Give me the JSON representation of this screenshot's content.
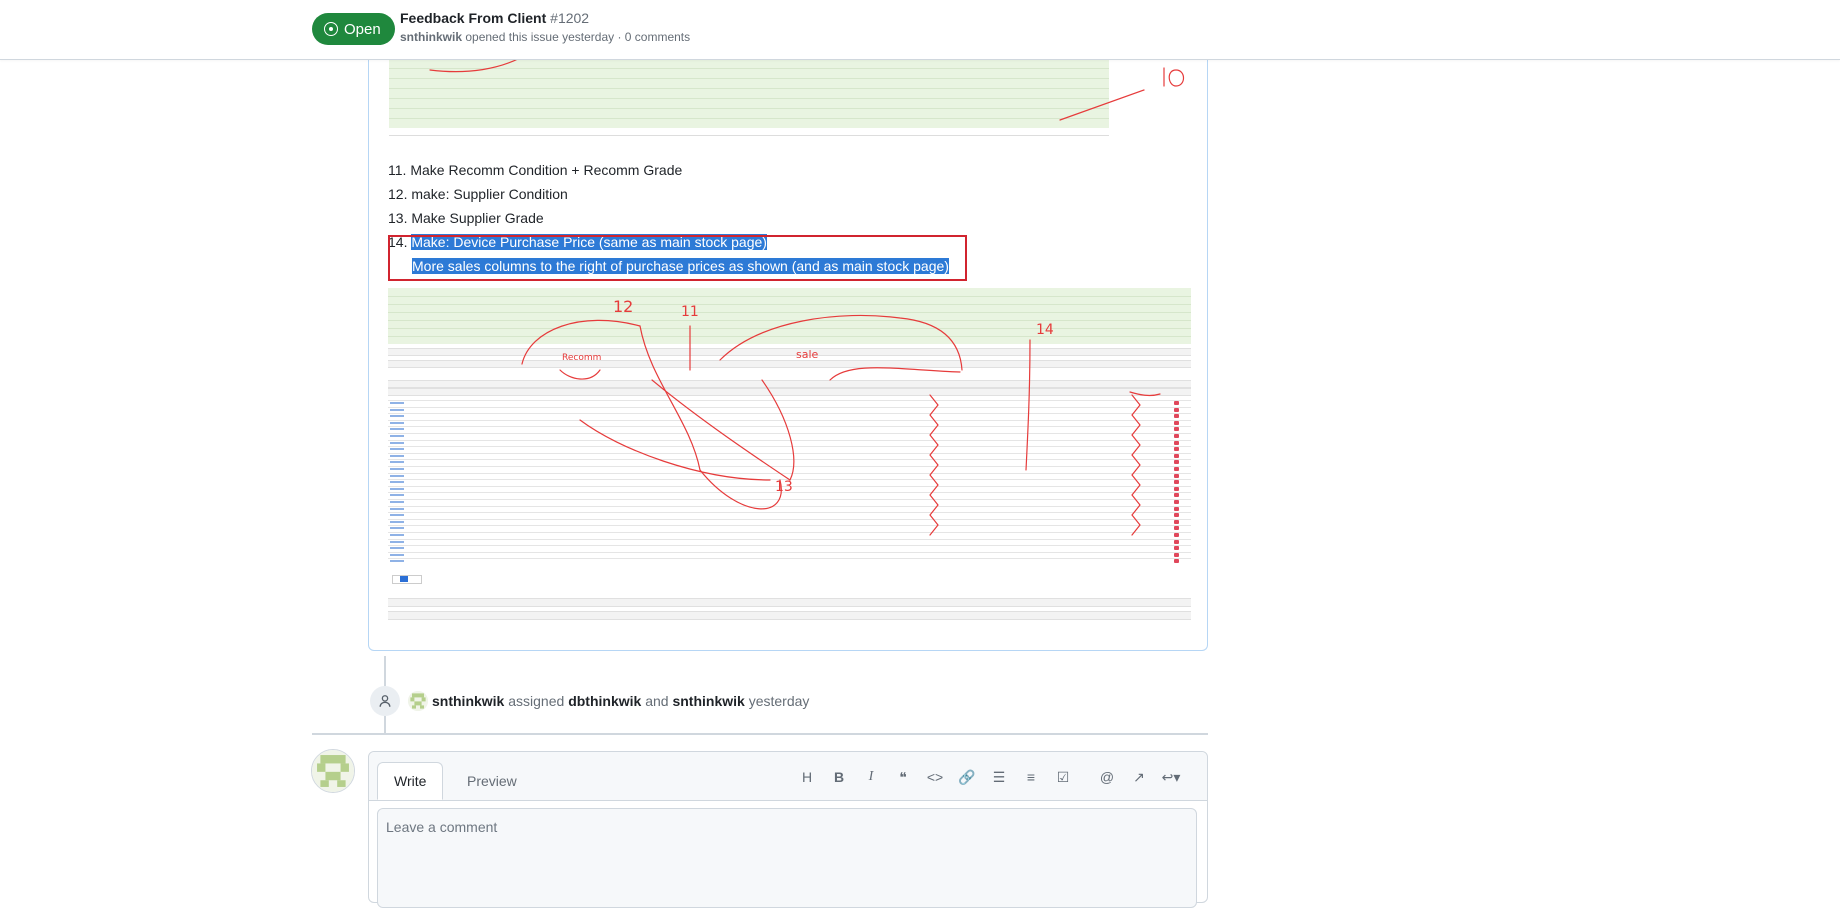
{
  "header": {
    "state": "Open",
    "title": "Feedback From Client",
    "number": "#1202",
    "author": "snthinkwik",
    "meta": "opened this issue yesterday · 0 comments"
  },
  "body": {
    "steps": [
      {
        "num": "11.",
        "text": "Make Recomm Condition + Recomm Grade"
      },
      {
        "num": "12.",
        "text": "make: Supplier Condition"
      },
      {
        "num": "13.",
        "text": "Make Supplier Grade"
      },
      {
        "num": "14.",
        "text": "Make: Device Purchase Price (same as main stock page)"
      }
    ],
    "step14_line2": "More sales columns to the right of purchase prices as shown (and as main stock page)",
    "annotations": [
      "10",
      "12",
      "11",
      "14",
      "13",
      "Recomm",
      "sale"
    ]
  },
  "event": {
    "actor": "snthinkwik",
    "verb": "assigned",
    "assignee1": "dbthinkwik",
    "and": "and",
    "assignee2": "snthinkwik",
    "when": "yesterday"
  },
  "editor": {
    "write_tab": "Write",
    "preview_tab": "Preview",
    "placeholder": "Leave a comment",
    "toolbar": [
      "heading-icon",
      "bold-icon",
      "italic-icon",
      "quote-icon",
      "code-icon",
      "link-icon",
      "unordered-list-icon",
      "ordered-list-icon",
      "task-list-icon",
      "mention-icon",
      "cross-reference-icon",
      "reply-icon"
    ]
  },
  "colors": {
    "open": "#1f883d",
    "highlight": "#2d7ad6",
    "annotation": "#e63b3b",
    "red_rect": "#d1242f"
  }
}
